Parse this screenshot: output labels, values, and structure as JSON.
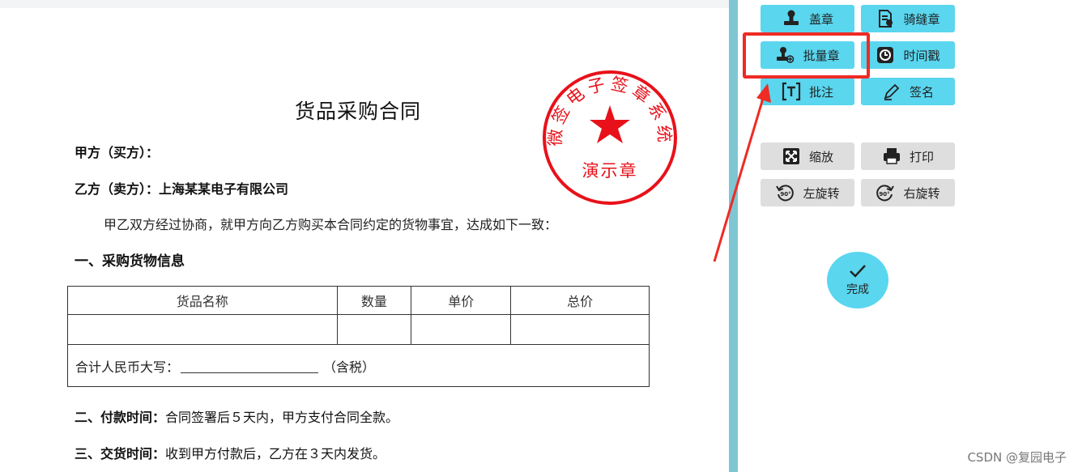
{
  "document": {
    "title": "货品采购合同",
    "party_a": "甲方（买方）：",
    "party_b": "乙方（卖方）：上海某某电子有限公司",
    "intro": "甲乙双方经过协商，就甲方向乙方购买本合同约定的货物事宜，达成如下一致：",
    "section1": "一、采购货物信息",
    "table": {
      "headers": [
        "货品名称",
        "数量",
        "单价",
        "总价"
      ],
      "total_label": "合计人民币大写：",
      "total_suffix": "（含税）"
    },
    "section2_head": "二、付款时间：",
    "section2_body": "合同签署后５天内，甲方支付合同全款。",
    "section3_head": "三、交货时间：",
    "section3_body": "收到甲方付款后，乙方在３天内发货。"
  },
  "seal": {
    "arc_text": "微签电子签章系统",
    "bottom_text": "演示章",
    "color": "#e8111a"
  },
  "toolbar": {
    "stamp": "盖章",
    "seam_stamp": "骑缝章",
    "batch_stamp": "批量章",
    "timestamp": "时间戳",
    "annotate": "批注",
    "sign": "签名",
    "zoom": "缩放",
    "print": "打印",
    "rotate_left": "左旋转",
    "rotate_right": "右旋转",
    "done": "完成",
    "accent": "#5ad6ef",
    "highlight": "#ee2b24"
  },
  "watermark": "CSDN @复园电子"
}
